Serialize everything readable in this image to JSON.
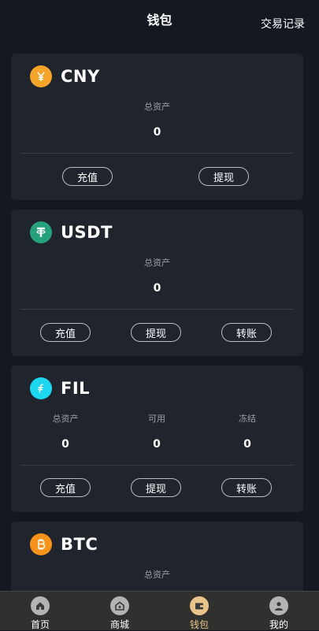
{
  "header": {
    "title": "钱包",
    "records_link": "交易记录"
  },
  "cards": [
    {
      "name": "CNY",
      "icon": "yuan-icon",
      "icon_color": "#f5a52a",
      "stats": [
        {
          "label": "总资产",
          "value": "0"
        }
      ],
      "buttons": [
        "充值",
        "提现"
      ]
    },
    {
      "name": "USDT",
      "icon": "tether-icon",
      "icon_color": "#26a17b",
      "stats": [
        {
          "label": "总资产",
          "value": "0"
        }
      ],
      "buttons": [
        "充值",
        "提现",
        "转账"
      ]
    },
    {
      "name": "FIL",
      "icon": "filecoin-icon",
      "icon_color": "#1dd6f0",
      "stats": [
        {
          "label": "总资产",
          "value": "0"
        },
        {
          "label": "可用",
          "value": "0"
        },
        {
          "label": "冻结",
          "value": "0"
        }
      ],
      "buttons": [
        "充值",
        "提现",
        "转账"
      ]
    },
    {
      "name": "BTC",
      "icon": "bitcoin-icon",
      "icon_color": "#f7931a",
      "stats": [
        {
          "label": "总资产"
        }
      ]
    }
  ],
  "tabbar": [
    {
      "label": "首页",
      "icon": "home-icon",
      "active": false
    },
    {
      "label": "商城",
      "icon": "shop-icon",
      "active": false
    },
    {
      "label": "钱包",
      "icon": "wallet-icon",
      "active": true
    },
    {
      "label": "我的",
      "icon": "user-icon",
      "active": false
    }
  ],
  "colors": {
    "accent": "#e8c48a",
    "background": "#141820",
    "card": "#20242c"
  }
}
